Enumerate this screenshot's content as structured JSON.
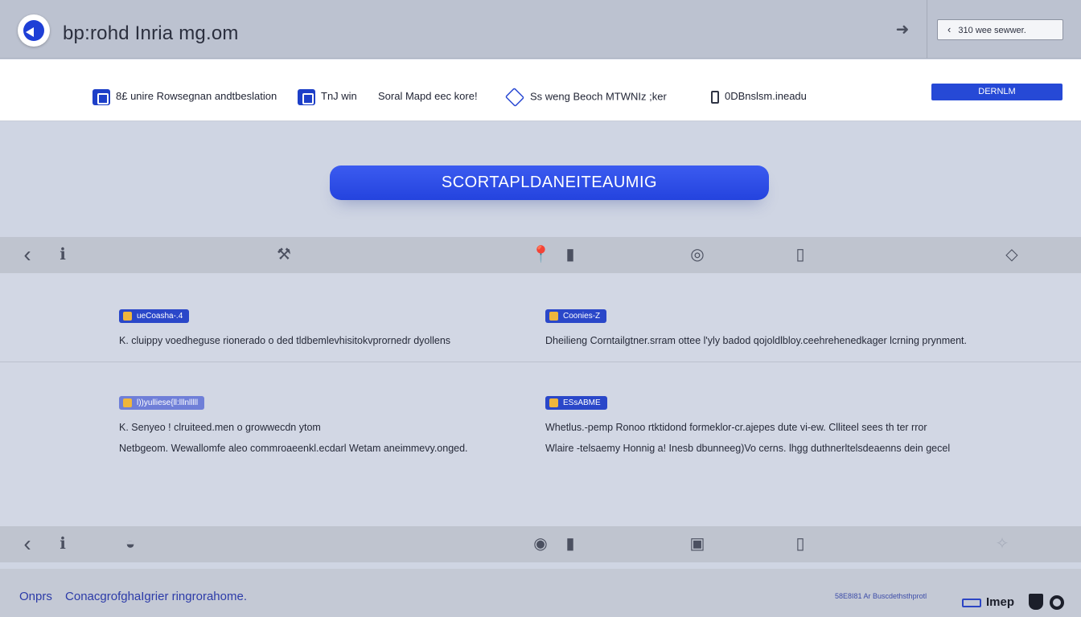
{
  "header": {
    "site_title": "bp:rohd Inria mg.om",
    "nav_icon": "share-arrow-icon",
    "back_button": {
      "icon": "chevron-left-icon",
      "label": "310 wee sewwer."
    }
  },
  "toolbar": {
    "items": [
      {
        "icon": "app-icon",
        "label": "8£ unire Rowsegnan andtbeslation"
      },
      {
        "icon": "app-icon",
        "label": "TnJ win"
      },
      {
        "icon": "",
        "label": "Soral Mapd eec kore!"
      },
      {
        "icon": "cube-icon",
        "label": "Ss weng Beoch MTWNIz ;ker"
      },
      {
        "icon": "phone-icon",
        "label": "0DBnslsm.ineadu"
      }
    ],
    "action_button": "DERNLM"
  },
  "hero": {
    "button_label": "SCORTAPLDANEITEAUMIG"
  },
  "icon_strip": [
    "chevron-left-icon",
    "info-icon",
    "wrench-icon",
    "pin-icon",
    "capsule-icon",
    "globe-icon",
    "phone-icon",
    "diamond-icon"
  ],
  "cards": [
    {
      "tag": "ueCoasha-.4",
      "lines": [
        "K. cluippy voedheguse rionerado o ded tldbemlevhisitokvprornedr dyollens"
      ]
    },
    {
      "tag": "Coonies-Z",
      "lines": [
        "Dheilieng Corntailgtner.srram ottee l'yly badod qojoldlbloy.ceehrehenedkager lcrning prynment."
      ]
    },
    {
      "tag": "l))yulliese{ll:lllnlllll",
      "lines": [
        "K. Senyeo ! clruiteed.men o growwecdn ytom",
        "Netbgeom. Wewallomfe aleo commroaeenkl.ecdarl Wetam aneimmevy.onged."
      ]
    },
    {
      "tag": "ESsABME",
      "lines": [
        "Whetlus.-pemp Ronoo rtktidond formeklor-cr.ajepes dute vi-ew. Clliteel sees th ter rror",
        "Wlaire -telsaemy Honnig a! Inesb dbunneeg)Vo cerns. lhgg duthnerltelsdeaenns dein gecel"
      ]
    }
  ],
  "footer": {
    "links": [
      "Onprs",
      "ConacgrofghaIgrier ringrorahome."
    ],
    "meta": "58E8I81 Ar Buscdethsthprotl",
    "brand": "Imep"
  },
  "colors": {
    "accent": "#2649d6",
    "header_bg": "#bcc2d0",
    "content_bg": "#d2d7e4"
  }
}
